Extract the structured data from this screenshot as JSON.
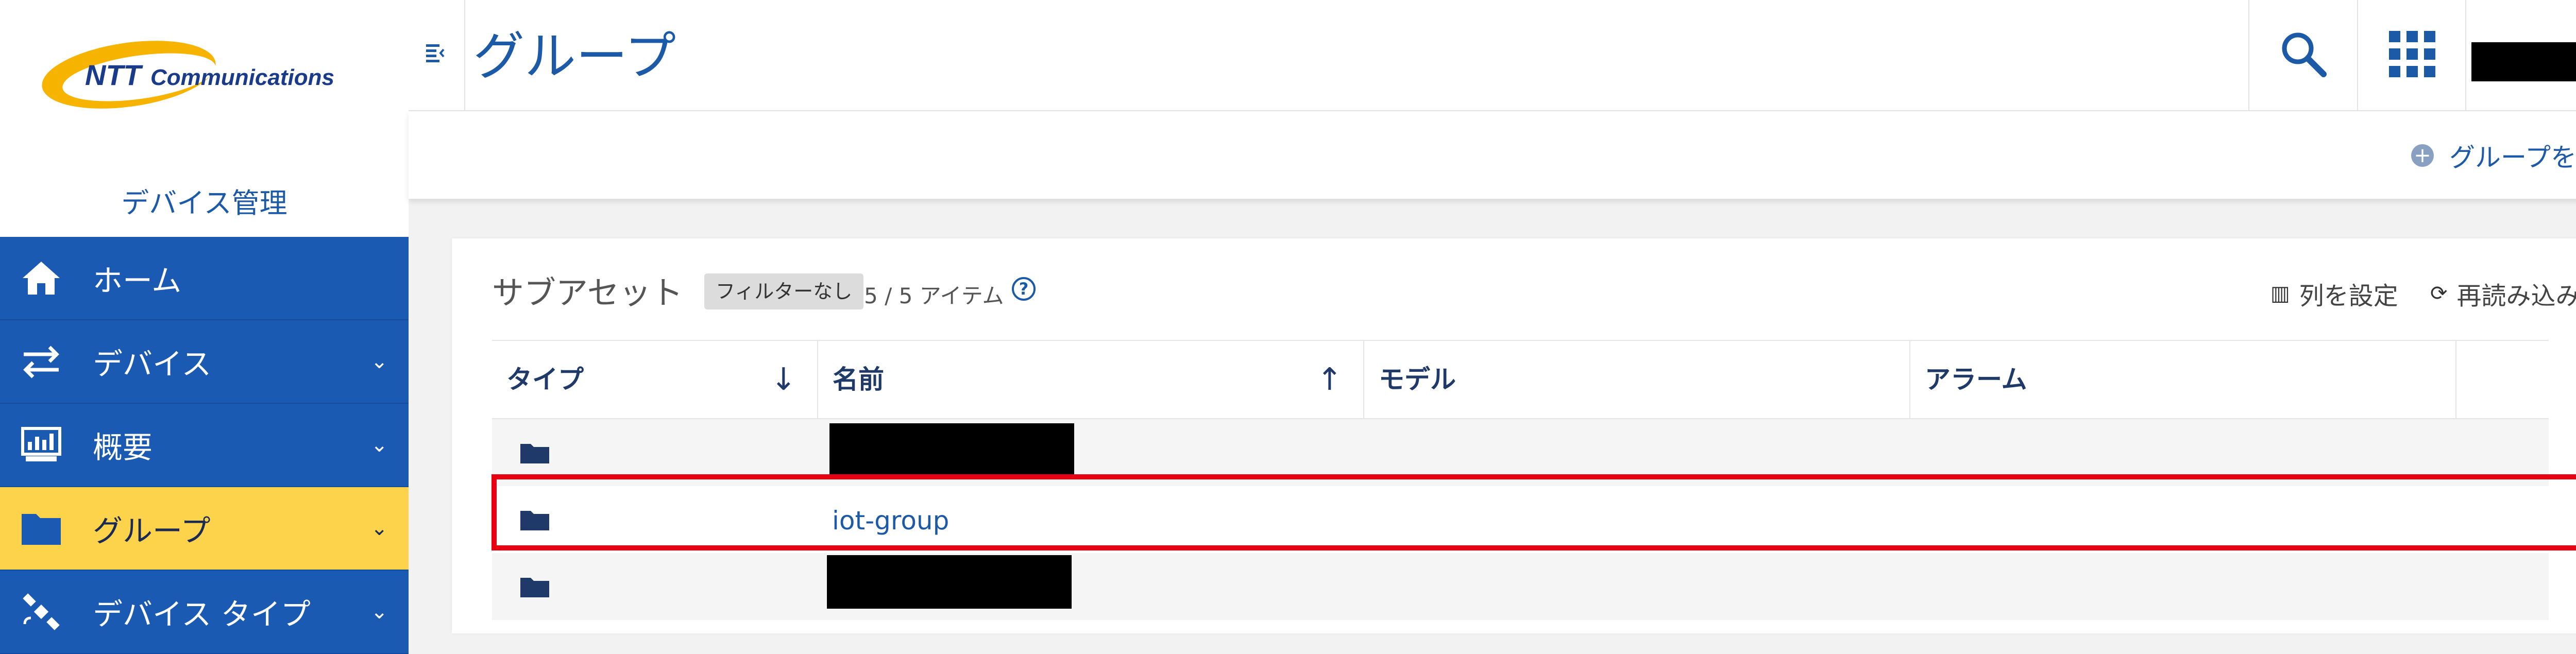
{
  "brand": {
    "logo_text_ntt": "NTT",
    "logo_text_comm": "Communications"
  },
  "sidebar": {
    "app_title": "デバイス管理",
    "items": [
      {
        "label": "ホーム",
        "icon": "home-icon",
        "has_chevron": false,
        "active": false
      },
      {
        "label": "デバイス",
        "icon": "arrows-exchange-icon",
        "has_chevron": true,
        "active": false
      },
      {
        "label": "概要",
        "icon": "dashboard-icon",
        "has_chevron": true,
        "active": false
      },
      {
        "label": "グループ",
        "icon": "folder-icon",
        "has_chevron": true,
        "active": true
      },
      {
        "label": "デバイス タイプ",
        "icon": "satellite-icon",
        "has_chevron": true,
        "active": false
      }
    ],
    "chevron": "⌄"
  },
  "header": {
    "title": "グループ"
  },
  "subheader": {
    "add_group_label": "グループを追加"
  },
  "card": {
    "title": "サブアセット",
    "filter_badge": "フィルターなし",
    "item_count": "5 / 5 アイテム",
    "help": "?",
    "columns_button": "列を設定",
    "reload_button": "再読み込み"
  },
  "table": {
    "headers": [
      "タイプ",
      "名前",
      "モデル",
      "アラーム"
    ],
    "sort_down": "↓",
    "sort_up": "↑",
    "rows": [
      {
        "type": "folder",
        "name": ""
      },
      {
        "type": "folder",
        "name": "iot-group"
      },
      {
        "type": "folder",
        "name": ""
      }
    ]
  },
  "colors": {
    "brand_blue": "#1c5aa8",
    "nav_blue": "#1b5ab3",
    "nav_active": "#fdd34c",
    "highlight": "#e60012"
  }
}
